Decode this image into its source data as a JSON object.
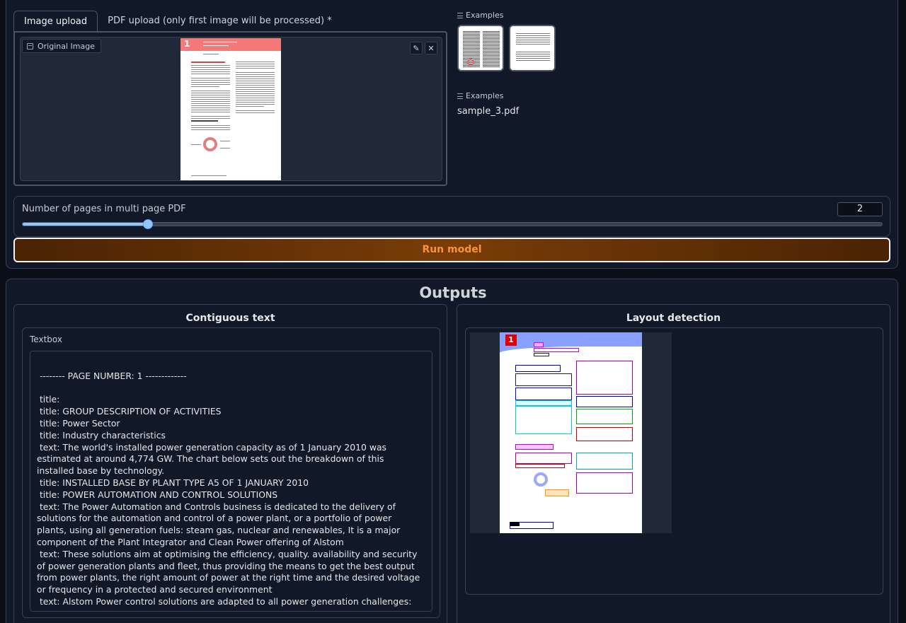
{
  "tabs": [
    {
      "label": "Image upload",
      "active": true
    },
    {
      "label": "PDF upload (only first image will be processed) *",
      "active": false
    }
  ],
  "image_component": {
    "label": "Original Image",
    "doc_number": "1"
  },
  "examples": [
    {
      "label": "Examples",
      "type": "image-thumbnails",
      "count": 2
    },
    {
      "label": "Examples",
      "files": [
        "sample_3.pdf"
      ]
    }
  ],
  "slider": {
    "label": "Number of pages in multi page PDF",
    "value": 2,
    "fill_fraction": 0.146
  },
  "run_button": {
    "label": "Run model"
  },
  "outputs": {
    "title": "Outputs",
    "contiguous": {
      "title": "Contiguous text",
      "textbox_label": "Textbox",
      "text": "\n -------- PAGE NUMBER: 1 -------------\n\n title:\n title: GROUP DESCRIPTION OF ACTIVITIES\n title: Power Sector\n title: Industry characteristics\n text: The world's installed power generation capacity as of 1 January 2010 was estimated at around 4,774 GW. The chart below sets out the breakdown of this installed base by technology.\n title: INSTALLED BASE BY PLANT TYPE A5 OF 1 JANUARY 2010\n title: POWER AUTOMATION AND CONTROL SOLUTIONS\n text: The Power Automation and Controls business is dedicated to the delivery of solutions for the automation and control of a power plant, or a portfolio of power plants, using all generation fuels: steam gas, nuclear and renewables, It is a major component of the Plant Integrator and Clean Power offering of Alstom\n text: These solutions aim at optimising the efficiency, quality. availability and security of power generation plants and fleet, thus providing the means to get the best output from power plants, the right amount of power at the right time and the desired voltage or frequency in a protected and secured environment\n text: Alstom Power control solutions are adapted to all power generation challenges:"
    },
    "layout": {
      "title": "Layout detection",
      "doc_number": "1"
    }
  },
  "colors": {
    "accent": "#93c5fd",
    "run_button_text": "#fb923c",
    "doc_band": "#f47a7a"
  }
}
